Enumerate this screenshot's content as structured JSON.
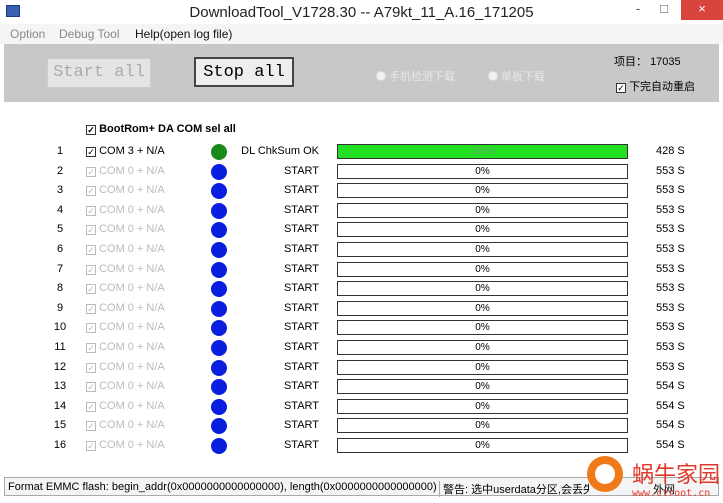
{
  "window": {
    "title": "DownloadTool_V1728.30 -- A79kt_11_A.16_171205",
    "minimize": "-",
    "maximize": "□",
    "close": "×"
  },
  "menu": [
    "Option",
    "Debug Tool",
    "Help(open log file)"
  ],
  "toolbar": {
    "start_label": "Start all",
    "stop_label": "Stop all",
    "radio1": "手机检测下载",
    "radio2": "单板下载",
    "project_label": "项目：",
    "project_value": "17035",
    "auto_reboot_label": "下完自动重启",
    "auto_reboot_checked": true
  },
  "sel_all": {
    "label": "BootRom+ DA COM sel all",
    "checked": true
  },
  "colors": {
    "green_dot": "#1a8a1a",
    "blue_dot": "#0a1ee0",
    "progress": "#22e022"
  },
  "rows": [
    {
      "n": "1",
      "com": "COM 3 + N/A",
      "enabled": true,
      "dot": "green",
      "status": "DL ChkSum OK",
      "progress": 100,
      "pct": "100%",
      "time": "428 S"
    },
    {
      "n": "2",
      "com": "COM 0 + N/A",
      "enabled": false,
      "dot": "blue",
      "status": "START",
      "progress": 0,
      "pct": "0%",
      "time": "553 S"
    },
    {
      "n": "3",
      "com": "COM 0 + N/A",
      "enabled": false,
      "dot": "blue",
      "status": "START",
      "progress": 0,
      "pct": "0%",
      "time": "553 S"
    },
    {
      "n": "4",
      "com": "COM 0 + N/A",
      "enabled": false,
      "dot": "blue",
      "status": "START",
      "progress": 0,
      "pct": "0%",
      "time": "553 S"
    },
    {
      "n": "5",
      "com": "COM 0 + N/A",
      "enabled": false,
      "dot": "blue",
      "status": "START",
      "progress": 0,
      "pct": "0%",
      "time": "553 S"
    },
    {
      "n": "6",
      "com": "COM 0 + N/A",
      "enabled": false,
      "dot": "blue",
      "status": "START",
      "progress": 0,
      "pct": "0%",
      "time": "553 S"
    },
    {
      "n": "7",
      "com": "COM 0 + N/A",
      "enabled": false,
      "dot": "blue",
      "status": "START",
      "progress": 0,
      "pct": "0%",
      "time": "553 S"
    },
    {
      "n": "8",
      "com": "COM 0 + N/A",
      "enabled": false,
      "dot": "blue",
      "status": "START",
      "progress": 0,
      "pct": "0%",
      "time": "553 S"
    },
    {
      "n": "9",
      "com": "COM 0 + N/A",
      "enabled": false,
      "dot": "blue",
      "status": "START",
      "progress": 0,
      "pct": "0%",
      "time": "553 S"
    },
    {
      "n": "10",
      "com": "COM 0 + N/A",
      "enabled": false,
      "dot": "blue",
      "status": "START",
      "progress": 0,
      "pct": "0%",
      "time": "553 S"
    },
    {
      "n": "11",
      "com": "COM 0 + N/A",
      "enabled": false,
      "dot": "blue",
      "status": "START",
      "progress": 0,
      "pct": "0%",
      "time": "553 S"
    },
    {
      "n": "12",
      "com": "COM 0 + N/A",
      "enabled": false,
      "dot": "blue",
      "status": "START",
      "progress": 0,
      "pct": "0%",
      "time": "553 S"
    },
    {
      "n": "13",
      "com": "COM 0 + N/A",
      "enabled": false,
      "dot": "blue",
      "status": "START",
      "progress": 0,
      "pct": "0%",
      "time": "554 S"
    },
    {
      "n": "14",
      "com": "COM 0 + N/A",
      "enabled": false,
      "dot": "blue",
      "status": "START",
      "progress": 0,
      "pct": "0%",
      "time": "554 S"
    },
    {
      "n": "15",
      "com": "COM 0 + N/A",
      "enabled": false,
      "dot": "blue",
      "status": "START",
      "progress": 0,
      "pct": "0%",
      "time": "554 S"
    },
    {
      "n": "16",
      "com": "COM 0 + N/A",
      "enabled": false,
      "dot": "blue",
      "status": "START",
      "progress": 0,
      "pct": "0%",
      "time": "554 S"
    }
  ],
  "statusbar": {
    "left": "Format EMMC flash:  begin_addr(0x0000000000000000), length(0x0000000000000000)",
    "mid": "警告: 选中userdata分区,会丢失",
    "right": "外网"
  },
  "watermark": {
    "text": "蜗牛家园",
    "url": "www.ctroot.cn"
  }
}
